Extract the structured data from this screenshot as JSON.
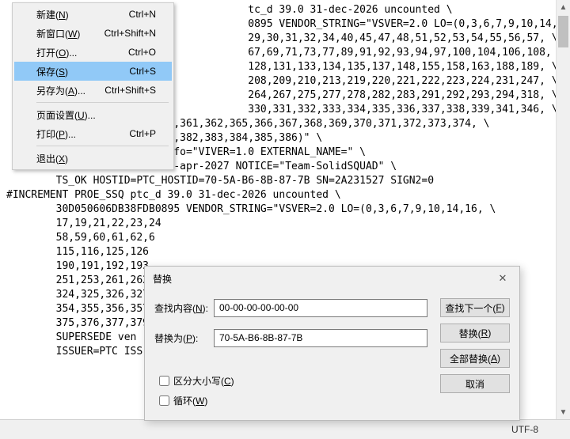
{
  "menu": {
    "items": [
      {
        "label": "新建(N)",
        "key": "N",
        "shortcut": "Ctrl+N"
      },
      {
        "label": "新窗口(W)",
        "key": "W",
        "shortcut": "Ctrl+Shift+N"
      },
      {
        "label": "打开(O)...",
        "key": "O",
        "shortcut": "Ctrl+O"
      },
      {
        "label": "保存(S)",
        "key": "S",
        "shortcut": "Ctrl+S"
      },
      {
        "label": "另存为(A)...",
        "key": "A",
        "shortcut": "Ctrl+Shift+S"
      }
    ],
    "items2": [
      {
        "label": "页面设置(U)...",
        "key": "U",
        "shortcut": ""
      },
      {
        "label": "打印(P)...",
        "key": "P",
        "shortcut": "Ctrl+P"
      }
    ],
    "items3": [
      {
        "label": "退出(X)",
        "key": "X",
        "shortcut": ""
      }
    ]
  },
  "editor": {
    "text": "                                       tc_d 39.0 31-dec-2026 uncounted \\\n                                       0895 VENDOR_STRING=\"VSVER=2.0 LO=(0,3,6,7,9,10,14,16, \\\n                                       29,30,31,32,34,40,45,47,48,51,52,53,54,55,56,57, \\\n                                       67,69,71,73,77,89,91,92,93,94,97,100,104,106,108, \\\n                                       128,131,133,134,135,137,148,155,158,163,188,189, \\\n                                       208,209,210,213,219,220,221,222,223,224,231,247, \\\n                                       264,267,275,277,278,282,283,291,292,293,294,318, \\\n                                       330,331,332,333,334,335,336,337,338,339,341,346, \\\n        354,355,356,357,359,361,362,365,366,367,368,369,370,371,372,373,374, \\\n        375,376,377,379,381,382,383,384,385,386)\" \\\n        SUPERSEDE vendor_info=\"VIVER=1.0 EXTERNAL_NAME=\" \\\n        ISSUER=PTC ISSUED=2-apr-2027 NOTICE=\"Team-SolidSQUAD\" \\\n        TS_OK HOSTID=PTC_HOSTID=70-5A-B6-8B-87-7B SN=2A231527 SIGN2=0\n#INCREMENT PROE_SSQ ptc_d 39.0 31-dec-2026 uncounted \\\n        30D050606DB38FDB0895 VENDOR_STRING=\"VSVER=2.0 LO=(0,3,6,7,9,10,14,16, \\\n        17,19,21,22,23,24\n        58,59,60,61,62,6\n        115,116,125,126\n        190,191,192,193\n        251,253,261,262\n        324,325,326,327\n        354,355,356,357\n        375,376,377,379\n        SUPERSEDE ven\n        ISSUER=PTC ISS"
  },
  "dialog": {
    "title": "替换",
    "find_label": "查找内容(N):",
    "replace_label": "替换为(P):",
    "find_value": "00-00-00-00-00-00",
    "replace_value": "70-5A-B6-8B-87-7B",
    "btn_findnext": "查找下一个(F)",
    "btn_replace": "替换(R)",
    "btn_replaceall": "全部替换(A)",
    "btn_cancel": "取消",
    "chk_case": "区分大小写(C)",
    "chk_wrap": "循环(W)"
  },
  "statusbar": {
    "encoding": "UTF-8"
  }
}
